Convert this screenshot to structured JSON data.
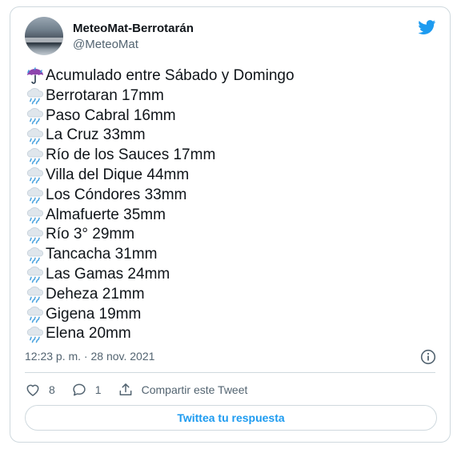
{
  "author": {
    "name": "MeteoMat-Berrotarán",
    "handle": "@MeteoMat"
  },
  "tweet": {
    "lines": [
      {
        "icon": "umbrella-rain-icon",
        "text": "Acumulado entre Sábado y Domingo"
      },
      {
        "icon": "rain-cloud-icon",
        "text": "Berrotaran 17mm"
      },
      {
        "icon": "rain-cloud-icon",
        "text": "Paso Cabral 16mm"
      },
      {
        "icon": "rain-cloud-icon",
        "text": "La Cruz 33mm"
      },
      {
        "icon": "rain-cloud-icon",
        "text": "Río de los Sauces 17mm"
      },
      {
        "icon": "rain-cloud-icon",
        "text": "Villa del Dique 44mm"
      },
      {
        "icon": "rain-cloud-icon",
        "text": "Los Cóndores 33mm"
      },
      {
        "icon": "rain-cloud-icon",
        "text": "Almafuerte 35mm"
      },
      {
        "icon": "rain-cloud-icon",
        "text": "Río 3° 29mm"
      },
      {
        "icon": "rain-cloud-icon",
        "text": "Tancacha 31mm"
      },
      {
        "icon": "rain-cloud-icon",
        "text": "Las Gamas 24mm"
      },
      {
        "icon": "rain-cloud-icon",
        "text": "Deheza 21mm"
      },
      {
        "icon": "rain-cloud-icon",
        "text": "Gigena 19mm"
      },
      {
        "icon": "rain-cloud-icon",
        "text": "Elena 20mm"
      }
    ],
    "timestamp": "12:23 p. m. · 28 nov. 2021"
  },
  "actions": {
    "likes": "8",
    "replies": "1",
    "share_label": "Compartir este Tweet"
  },
  "reply_button": "Twittea tu respuesta",
  "colors": {
    "accent": "#1d9bf0",
    "muted": "#536471",
    "border": "#cfd9de"
  }
}
